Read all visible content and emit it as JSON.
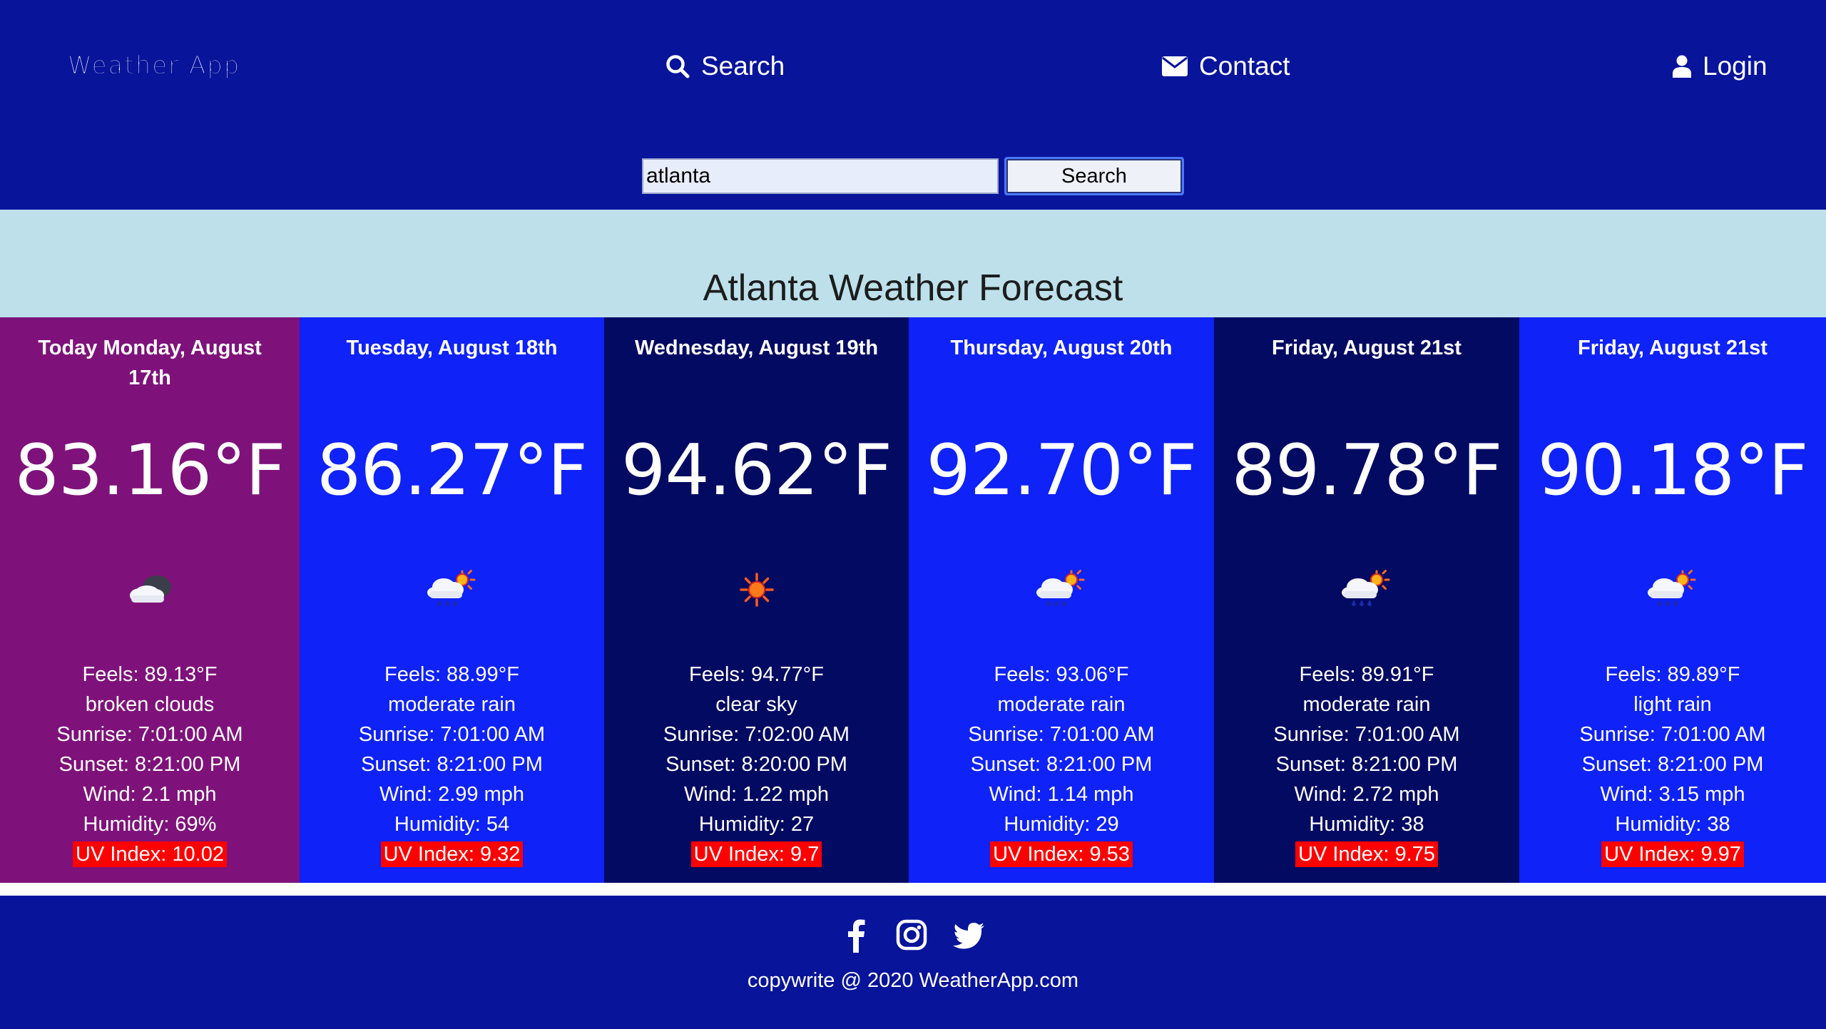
{
  "header": {
    "brand": "Weather App",
    "nav": {
      "search": "Search",
      "contact": "Contact",
      "login": "Login"
    },
    "search_form": {
      "value": "atlanta",
      "button": "Search"
    }
  },
  "title": "Atlanta Weather Forecast",
  "colors": {
    "header_bg": "#08149a",
    "title_band_bg": "#bde0ea",
    "today_bg": "#7e127a",
    "blue_bg": "#0f22f7",
    "navy_bg": "#030a62",
    "uv_bg": "#ff0000"
  },
  "days": [
    {
      "name": "Today Monday, August 17th",
      "temp": "83.16°F",
      "icon": "broken-clouds-icon",
      "feels": "Feels: 89.13°F",
      "desc": "broken clouds",
      "sunrise": "Sunrise: 7:01:00 AM",
      "sunset": "Sunset: 8:21:00 PM",
      "wind": "Wind: 2.1 mph",
      "humidity": "Humidity: 69%",
      "uv": "UV Index: 10.02"
    },
    {
      "name": "Tuesday, August 18th",
      "temp": "86.27°F",
      "icon": "rain-sun-icon",
      "feels": "Feels: 88.99°F",
      "desc": "moderate rain",
      "sunrise": "Sunrise: 7:01:00 AM",
      "sunset": "Sunset: 8:21:00 PM",
      "wind": "Wind: 2.99 mph",
      "humidity": "Humidity: 54",
      "uv": "UV Index: 9.32"
    },
    {
      "name": "Wednesday, August 19th",
      "temp": "94.62°F",
      "icon": "sun-icon",
      "feels": "Feels: 94.77°F",
      "desc": "clear sky",
      "sunrise": "Sunrise: 7:02:00 AM",
      "sunset": "Sunset: 8:20:00 PM",
      "wind": "Wind: 1.22 mph",
      "humidity": "Humidity: 27",
      "uv": "UV Index: 9.7"
    },
    {
      "name": "Thursday, August 20th",
      "temp": "92.70°F",
      "icon": "rain-sun-icon",
      "feels": "Feels: 93.06°F",
      "desc": "moderate rain",
      "sunrise": "Sunrise: 7:01:00 AM",
      "sunset": "Sunset: 8:21:00 PM",
      "wind": "Wind: 1.14 mph",
      "humidity": "Humidity: 29",
      "uv": "UV Index: 9.53"
    },
    {
      "name": "Friday, August 21st",
      "temp": "89.78°F",
      "icon": "rain-sun-icon",
      "feels": "Feels: 89.91°F",
      "desc": "moderate rain",
      "sunrise": "Sunrise: 7:01:00 AM",
      "sunset": "Sunset: 8:21:00 PM",
      "wind": "Wind: 2.72 mph",
      "humidity": "Humidity: 38",
      "uv": "UV Index: 9.75"
    },
    {
      "name": "Friday, August 21st",
      "temp": "90.18°F",
      "icon": "rain-sun-icon",
      "feels": "Feels: 89.89°F",
      "desc": "light rain",
      "sunrise": "Sunrise: 7:01:00 AM",
      "sunset": "Sunset: 8:21:00 PM",
      "wind": "Wind: 3.15 mph",
      "humidity": "Humidity: 38",
      "uv": "UV Index: 9.97"
    }
  ],
  "footer": {
    "socials": [
      "facebook-icon",
      "instagram-icon",
      "twitter-icon"
    ],
    "copyright": "copywrite @ 2020 WeatherApp.com"
  }
}
